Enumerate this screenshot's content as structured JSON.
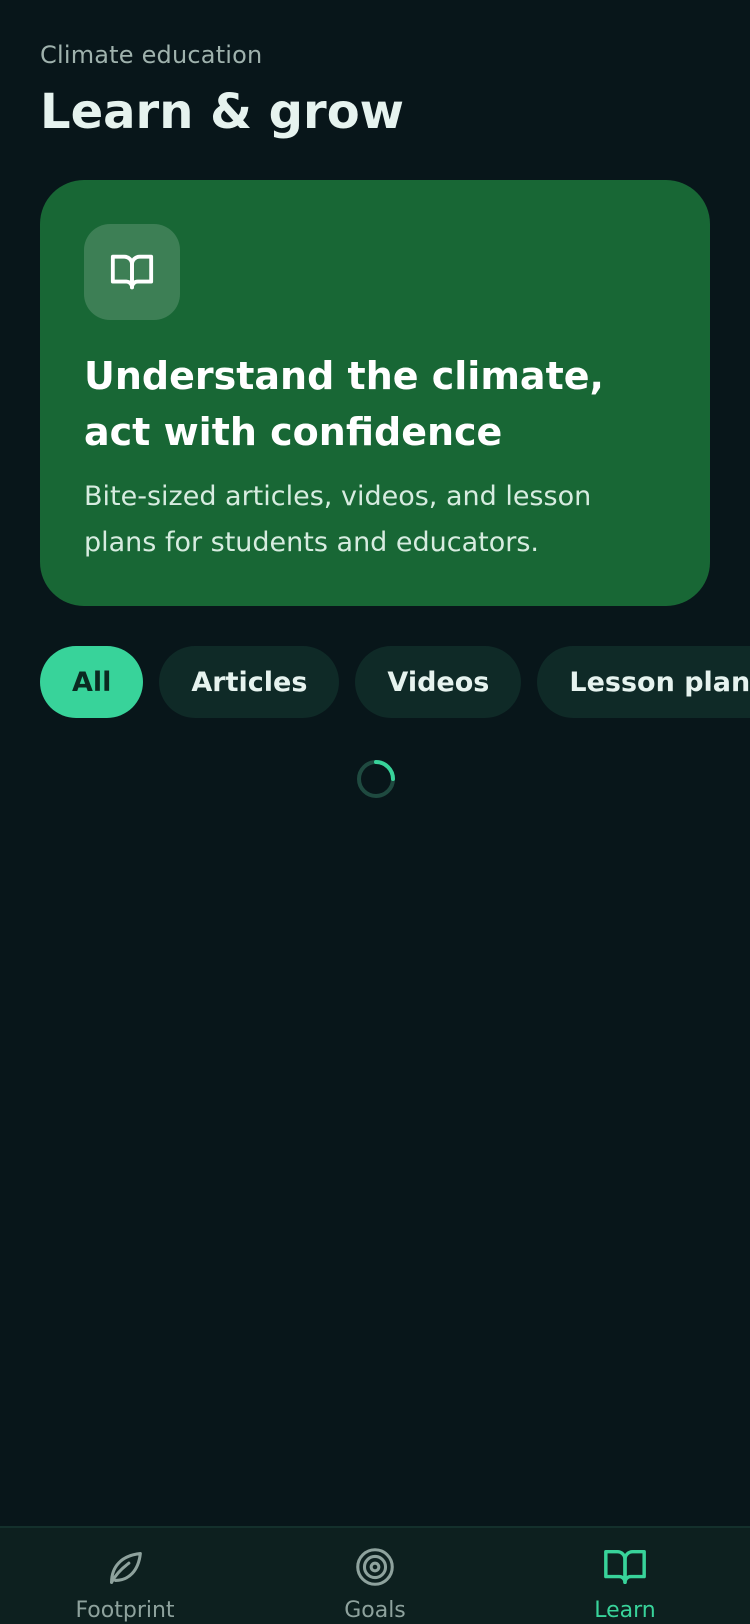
{
  "header": {
    "eyebrow": "Climate education",
    "title": "Learn & grow"
  },
  "hero": {
    "icon": "book-open-icon",
    "title": "Understand the climate, act with confidence",
    "subtitle": "Bite-sized articles, videos, and lesson plans for students and educators."
  },
  "filters": [
    {
      "label": "All",
      "active": true
    },
    {
      "label": "Articles",
      "active": false
    },
    {
      "label": "Videos",
      "active": false
    },
    {
      "label": "Lesson plans",
      "active": false
    }
  ],
  "loading": {
    "icon": "loading-spinner-icon"
  },
  "bottom_nav": {
    "items": [
      {
        "label": "Footprint",
        "icon": "leaf-icon",
        "active": false
      },
      {
        "label": "Goals",
        "icon": "target-icon",
        "active": false
      },
      {
        "label": "Learn",
        "icon": "book-open-icon",
        "active": true
      }
    ]
  },
  "colors": {
    "background": "#08161a",
    "hero": "#186735",
    "accent": "#38d39a",
    "chip": "#0f2a27"
  }
}
